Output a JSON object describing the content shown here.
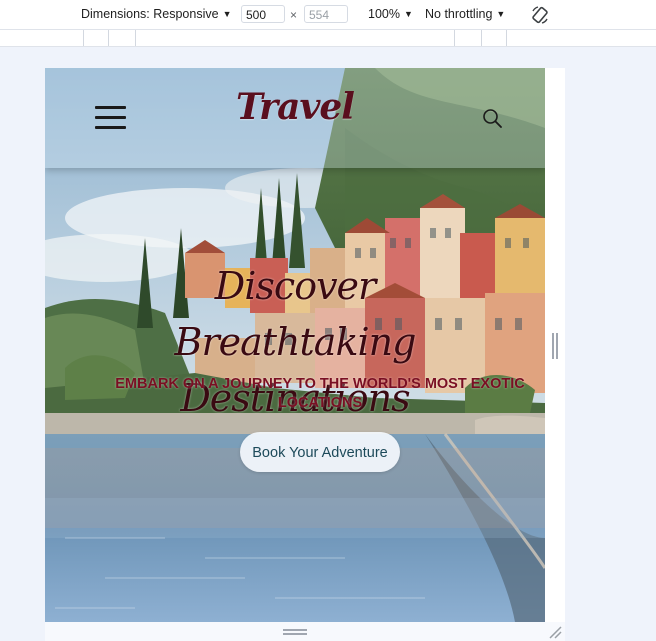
{
  "devtools": {
    "dimensions_label": "Dimensions: Responsive",
    "width_value": "500",
    "height_placeholder": "554",
    "times_sign": "×",
    "zoom_label": "100%",
    "throttling_label": "No throttling",
    "caret": "▼"
  },
  "site": {
    "logo": "Travel",
    "hero": {
      "title": "Discover Breathtaking Destinations",
      "subtitle": "EMBARK ON A JOURNEY TO THE WORLD'S MOST EXOTIC LOCATIONS",
      "cta_label": "Book Your Adventure"
    }
  },
  "icons": {
    "menu": "hamburger-menu-icon",
    "search": "search-icon",
    "rotate": "rotate-icon"
  },
  "colors": {
    "logo": "#5a0f1e",
    "hero_title": "#3a0a12",
    "hero_subtitle": "#7a0f23",
    "cta_text": "#1d4a5a",
    "devtools_bg": "#eff3fb"
  }
}
